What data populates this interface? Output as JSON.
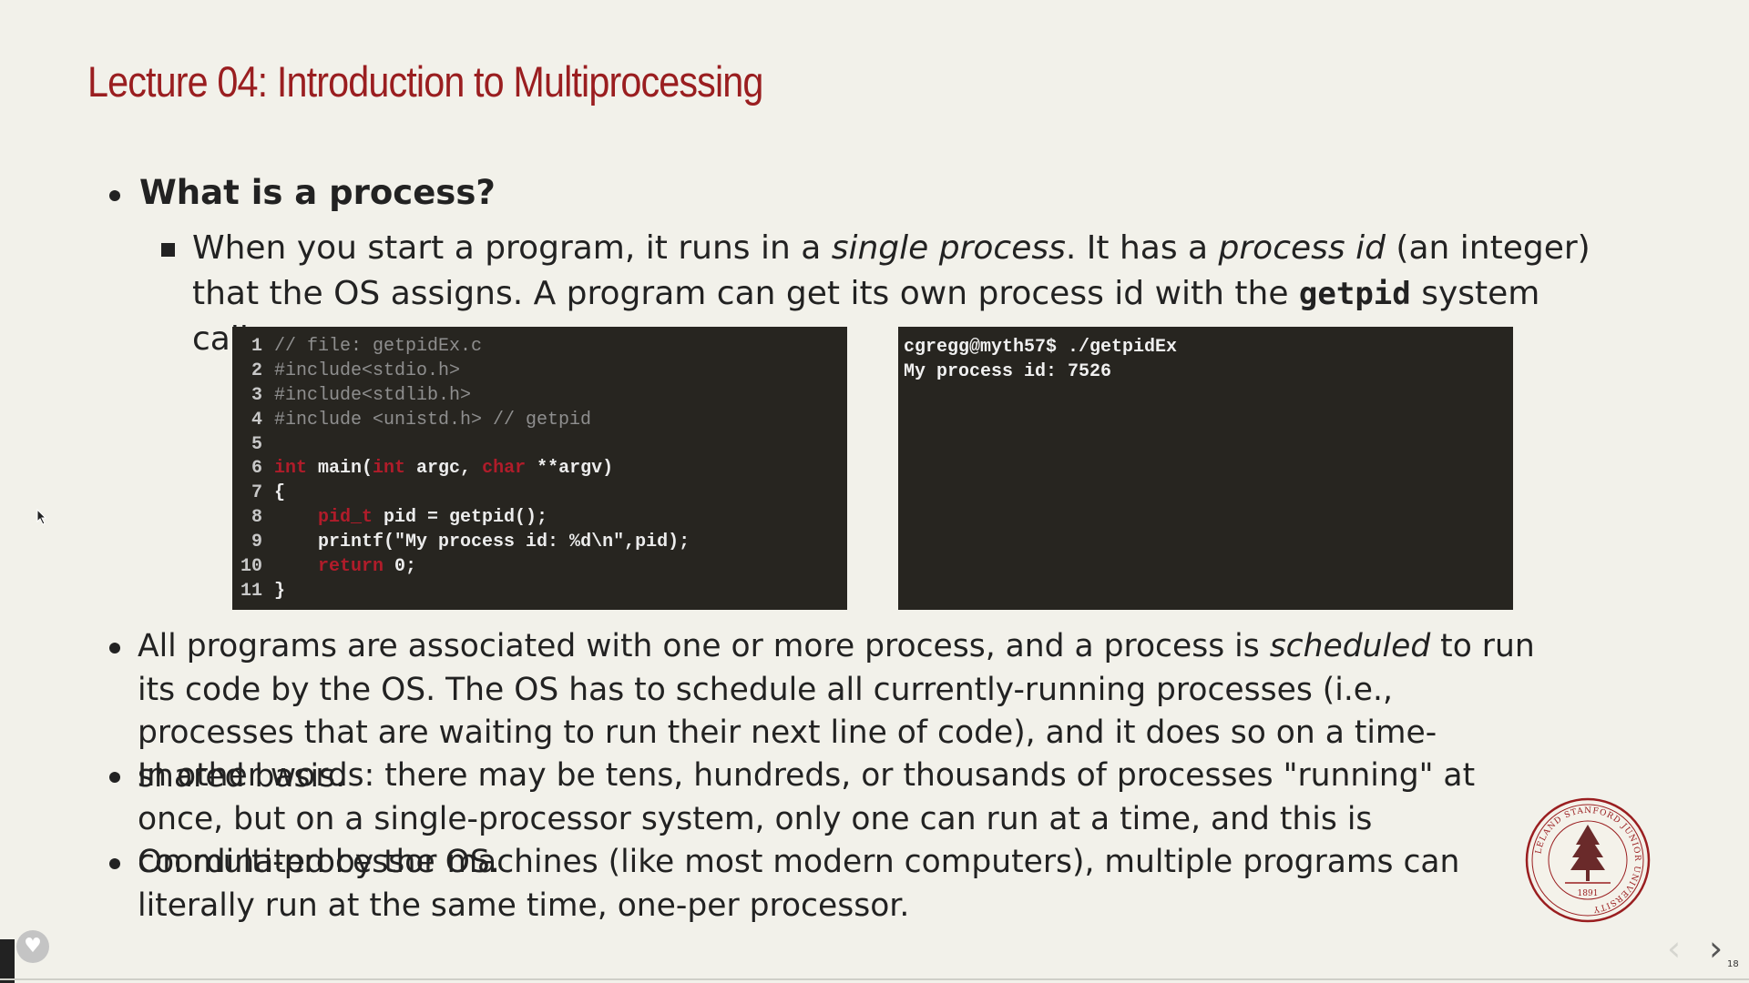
{
  "slide": {
    "title": "Lecture 04: Introduction to Multiprocessing",
    "question": "What is a process?",
    "sub": {
      "p1": "When you start a program, it runs in a ",
      "p1_em": "single process",
      "p2": ". It has a ",
      "p2_em": "process id",
      "p3": " (an integer) that the OS assigns. A program can get its own process id with the ",
      "p3_code": "getpid",
      "p4": " system call:"
    },
    "code": {
      "line_numbers": [
        "1",
        "2",
        "3",
        "4",
        "5",
        "6",
        "7",
        "8",
        "9",
        "10",
        "11"
      ],
      "l1": "// file: getpidEx.c",
      "l2": "#include<stdio.h>",
      "l3": "#include<stdlib.h>",
      "l4": "#include <unistd.h> // getpid",
      "l6_kw1": "int",
      "l6_a": " main(",
      "l6_kw2": "int",
      "l6_b": " argc, ",
      "l6_kw3": "char",
      "l6_c": " **argv)",
      "l7": "{",
      "l8_kw": "pid_t",
      "l8_rest": " pid = getpid();",
      "l9": "printf(\"My process id: %d\\n\",pid);",
      "l10_kw": "return",
      "l10_rest": " 0;",
      "l11": "}"
    },
    "terminal": {
      "line1": "cgregg@myth57$ ./getpidEx",
      "line2": "My process id: 7526"
    },
    "b1": {
      "a": "All programs are associated with one or more process, and a process is ",
      "em": "scheduled",
      "b": " to run its code by the OS. The OS has to schedule all currently-running processes (i.e., processes that are waiting to run their next line of code), and it does so on a time-shared basis."
    },
    "b2": "In other words: there may be tens, hundreds, or thousands of processes \"running\" at once, but on a single-processor system, only one can run at a time, and this is coordinated by the OS.",
    "b3": "On multi-processor machines (like most modern computers), multiple programs can literally run at the same time, one-per processor.",
    "seal_text": "LELAND STANFORD JUNIOR UNIVERSITY",
    "seal_year": "1891",
    "page_number": "18",
    "colors": {
      "title": "#9a1e20",
      "background": "#f2f1ea",
      "code_bg": "#272520",
      "keyword": "#b01c2a"
    },
    "icons": {
      "heart": "heart-icon",
      "prev": "chevron-left-icon",
      "next": "chevron-right-icon"
    }
  }
}
